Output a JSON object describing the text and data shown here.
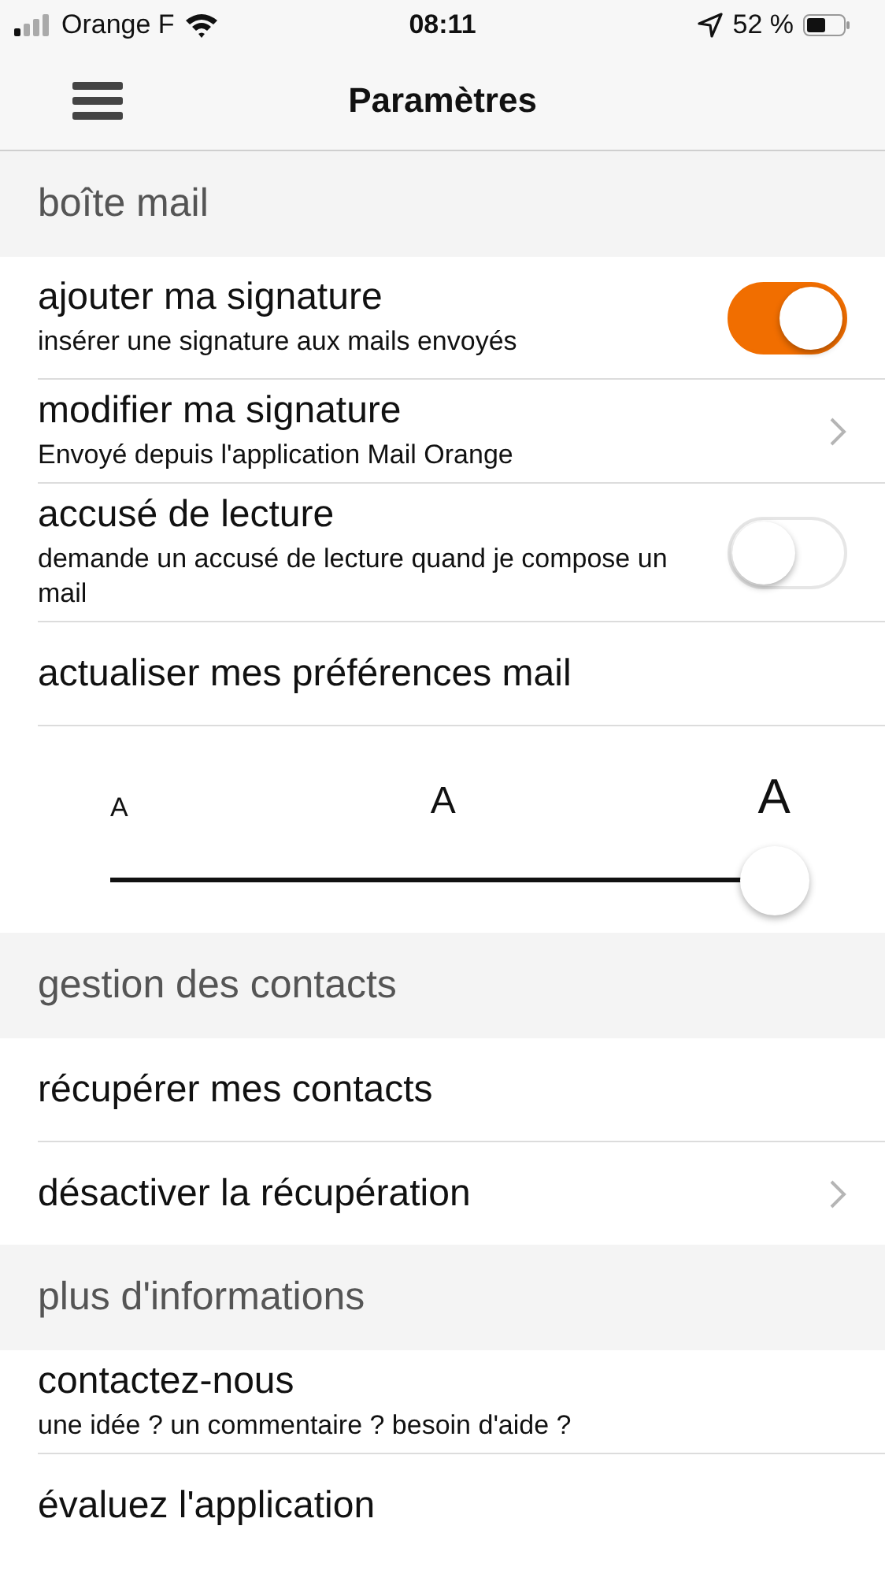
{
  "status_bar": {
    "carrier": "Orange F",
    "time": "08:11",
    "battery": "52 %"
  },
  "nav": {
    "title": "Paramètres"
  },
  "sections": [
    {
      "title": "boîte mail",
      "items": [
        {
          "kind": "toggle",
          "title": "ajouter ma signature",
          "subtitle": "insérer une signature aux mails envoyés",
          "on": true
        },
        {
          "kind": "link",
          "title": "modifier ma signature",
          "subtitle": "Envoyé depuis l'application Mail Orange"
        },
        {
          "kind": "toggle",
          "title": "accusé de lecture",
          "subtitle": "demande un accusé de lecture quand je compose un mail",
          "on": false
        },
        {
          "kind": "plain",
          "title": "actualiser mes préférences mail"
        },
        {
          "kind": "slider",
          "labels": [
            "A",
            "A",
            "A"
          ],
          "level": 1
        }
      ]
    },
    {
      "title": "gestion des contacts",
      "items": [
        {
          "kind": "plain",
          "title": "récupérer mes contacts"
        },
        {
          "kind": "link",
          "title": "désactiver la récupération"
        }
      ]
    },
    {
      "title": "plus d'informations",
      "items": [
        {
          "kind": "plain",
          "title": "contactez-nous",
          "subtitle": "une idée ? un commentaire ? besoin d'aide ?"
        },
        {
          "kind": "plain",
          "title": "évaluez l'application"
        }
      ]
    }
  ]
}
